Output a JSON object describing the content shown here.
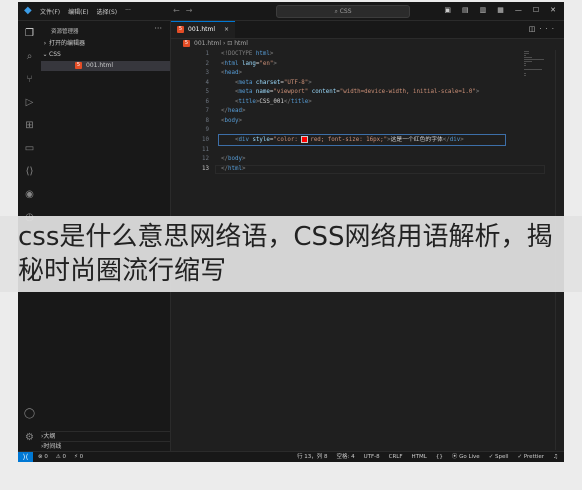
{
  "titlebar": {
    "menu": [
      "文件(F)",
      "编辑(E)",
      "选择(S)",
      "···"
    ],
    "search": "CSS"
  },
  "sidebar": {
    "title": "资源管理器",
    "more": "···",
    "open_editors": "打开的编辑器",
    "folder": "CSS",
    "file": "001.html",
    "outline": "大纲",
    "timeline": "时间线"
  },
  "editor": {
    "tab_label": "001.html",
    "breadcrumb_file": "001.html",
    "breadcrumb_node": "html",
    "lines": [
      {
        "n": "1",
        "segments": [
          {
            "c": "t-br",
            "t": "<!DOCTYPE "
          },
          {
            "c": "t-tag",
            "t": "html"
          },
          {
            "c": "t-br",
            "t": ">"
          }
        ]
      },
      {
        "n": "2",
        "segments": [
          {
            "c": "t-br",
            "t": "<"
          },
          {
            "c": "t-tag",
            "t": "html"
          },
          {
            "c": "t-attr",
            "t": " lang"
          },
          {
            "c": "t-text",
            "t": "="
          },
          {
            "c": "t-val",
            "t": "\"en\""
          },
          {
            "c": "t-br",
            "t": ">"
          }
        ]
      },
      {
        "n": "3",
        "segments": [
          {
            "c": "t-br",
            "t": "<"
          },
          {
            "c": "t-tag",
            "t": "head"
          },
          {
            "c": "t-br",
            "t": ">"
          }
        ]
      },
      {
        "n": "4",
        "segments": [
          {
            "c": "t-text",
            "t": "    "
          },
          {
            "c": "t-br",
            "t": "<"
          },
          {
            "c": "t-tag",
            "t": "meta"
          },
          {
            "c": "t-attr",
            "t": " charset"
          },
          {
            "c": "t-text",
            "t": "="
          },
          {
            "c": "t-val",
            "t": "\"UTF-8\""
          },
          {
            "c": "t-br",
            "t": ">"
          }
        ]
      },
      {
        "n": "5",
        "segments": [
          {
            "c": "t-text",
            "t": "    "
          },
          {
            "c": "t-br",
            "t": "<"
          },
          {
            "c": "t-tag",
            "t": "meta"
          },
          {
            "c": "t-attr",
            "t": " name"
          },
          {
            "c": "t-text",
            "t": "="
          },
          {
            "c": "t-val",
            "t": "\"viewport\""
          },
          {
            "c": "t-attr",
            "t": " content"
          },
          {
            "c": "t-text",
            "t": "="
          },
          {
            "c": "t-val",
            "t": "\"width=device-width, initial-scale=1.0\""
          },
          {
            "c": "t-br",
            "t": ">"
          }
        ]
      },
      {
        "n": "6",
        "segments": [
          {
            "c": "t-text",
            "t": "    "
          },
          {
            "c": "t-br",
            "t": "<"
          },
          {
            "c": "t-tag",
            "t": "title"
          },
          {
            "c": "t-br",
            "t": ">"
          },
          {
            "c": "t-text",
            "t": "CSS_001"
          },
          {
            "c": "t-br",
            "t": "</"
          },
          {
            "c": "t-tag",
            "t": "title"
          },
          {
            "c": "t-br",
            "t": ">"
          }
        ]
      },
      {
        "n": "7",
        "segments": [
          {
            "c": "t-br",
            "t": "</"
          },
          {
            "c": "t-tag",
            "t": "head"
          },
          {
            "c": "t-br",
            "t": ">"
          }
        ]
      },
      {
        "n": "8",
        "segments": [
          {
            "c": "t-br",
            "t": "<"
          },
          {
            "c": "t-tag",
            "t": "body"
          },
          {
            "c": "t-br",
            "t": ">"
          }
        ]
      },
      {
        "n": "9",
        "segments": []
      },
      {
        "n": "10",
        "segments": [
          {
            "c": "t-text",
            "t": "    "
          },
          {
            "c": "t-br",
            "t": "<"
          },
          {
            "c": "t-tag",
            "t": "div"
          },
          {
            "c": "t-attr",
            "t": " style"
          },
          {
            "c": "t-text",
            "t": "="
          },
          {
            "c": "t-val",
            "t": "\"color: "
          },
          {
            "c": "swatch",
            "t": ""
          },
          {
            "c": "t-val",
            "t": "red; font-size: 16px;\""
          },
          {
            "c": "t-br",
            "t": ">"
          },
          {
            "c": "t-text",
            "t": "这是一个红色的字体"
          },
          {
            "c": "t-br",
            "t": "</"
          },
          {
            "c": "t-tag",
            "t": "div"
          },
          {
            "c": "t-br",
            "t": ">"
          }
        ]
      },
      {
        "n": "11",
        "segments": []
      },
      {
        "n": "12",
        "segments": [
          {
            "c": "t-br",
            "t": "</"
          },
          {
            "c": "t-tag",
            "t": "body"
          },
          {
            "c": "t-br",
            "t": ">"
          }
        ]
      },
      {
        "n": "13",
        "segments": [
          {
            "c": "t-br",
            "t": "</"
          },
          {
            "c": "t-tag",
            "t": "html"
          },
          {
            "c": "t-br",
            "t": ">"
          }
        ]
      }
    ],
    "current_line": "13"
  },
  "statusbar": {
    "remote_icon": "remote-icon",
    "errors": "⊗ 0",
    "warnings": "⚠ 0",
    "ports": "⚡ 0",
    "position": "行 13，列 8",
    "spaces": "空格: 4",
    "encoding": "UTF-8",
    "eol": "CRLF",
    "language": "HTML",
    "golive": "Go Live",
    "spell": "✓ Spell",
    "prettier": "✓ Prettier"
  },
  "banner": {
    "text": "css是什么意思网络语，CSS网络用语解析，揭秘时尚圈流行缩写"
  },
  "colors": {
    "accent": "#0078d4",
    "editor_bg": "#1f1f1f",
    "sidebar_bg": "#181818",
    "html_icon": "#e44d26"
  }
}
